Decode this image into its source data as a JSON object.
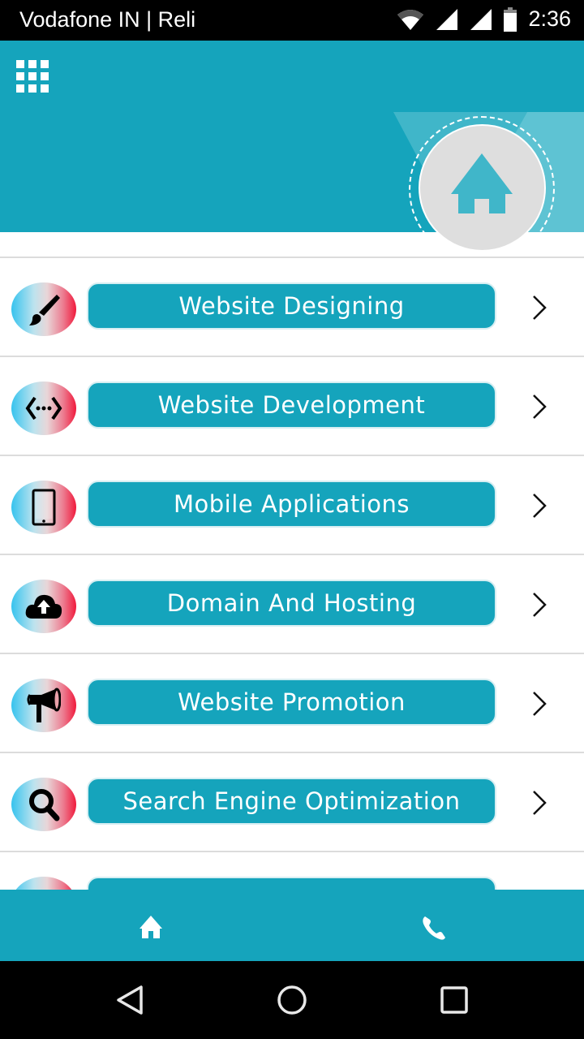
{
  "status_bar": {
    "carrier": "Vodafone IN | Reli",
    "time": "2:36",
    "icons": [
      "wifi-icon",
      "signal-icon",
      "signal-icon",
      "battery-icon"
    ]
  },
  "header": {
    "menu_icon": "grid-menu-icon",
    "badge_icon": "home-icon"
  },
  "colors": {
    "primary": "#15a4bc",
    "divider": "#dcdcdc",
    "badge_bg": "#dedede"
  },
  "services": [
    {
      "label": "Website Designing",
      "icon": "paintbrush-icon"
    },
    {
      "label": "Website Development",
      "icon": "code-icon"
    },
    {
      "label": "Mobile Applications",
      "icon": "mobile-phone-icon"
    },
    {
      "label": "Domain And Hosting",
      "icon": "cloud-upload-icon"
    },
    {
      "label": "Website Promotion",
      "icon": "megaphone-icon"
    },
    {
      "label": "Search Engine Optimization",
      "icon": "search-icon"
    },
    {
      "label": "",
      "icon": "partially-visible-icon"
    }
  ],
  "bottom_nav": {
    "items": [
      {
        "icon": "home-icon"
      },
      {
        "icon": "phone-icon"
      }
    ]
  },
  "system_nav": {
    "items": [
      "back-icon",
      "home-circle-icon",
      "recents-icon"
    ]
  }
}
